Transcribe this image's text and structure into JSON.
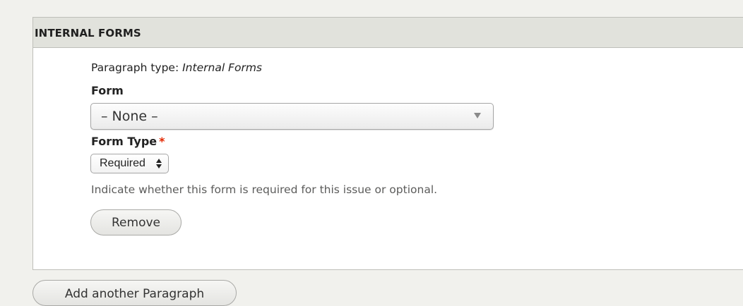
{
  "panel": {
    "title": "INTERNAL FORMS"
  },
  "paragraph_type": {
    "label": "Paragraph type:",
    "value": "Internal Forms"
  },
  "form_field": {
    "label": "Form",
    "selected": "– None –"
  },
  "form_type_field": {
    "label": "Form Type",
    "required_marker": "*",
    "selected": "Required",
    "description": "Indicate whether this form is required for this issue or optional."
  },
  "buttons": {
    "remove_label": "Remove",
    "add_another_label": "Add another Paragraph"
  },
  "colors": {
    "page_background": "#f1f1ed",
    "header_background": "#e1e2dc",
    "required_star": "#e32700"
  },
  "icons": {
    "form_select_arrow": "chevron-down-icon",
    "form_type_select_arrows": "up-down-arrows-icon"
  }
}
